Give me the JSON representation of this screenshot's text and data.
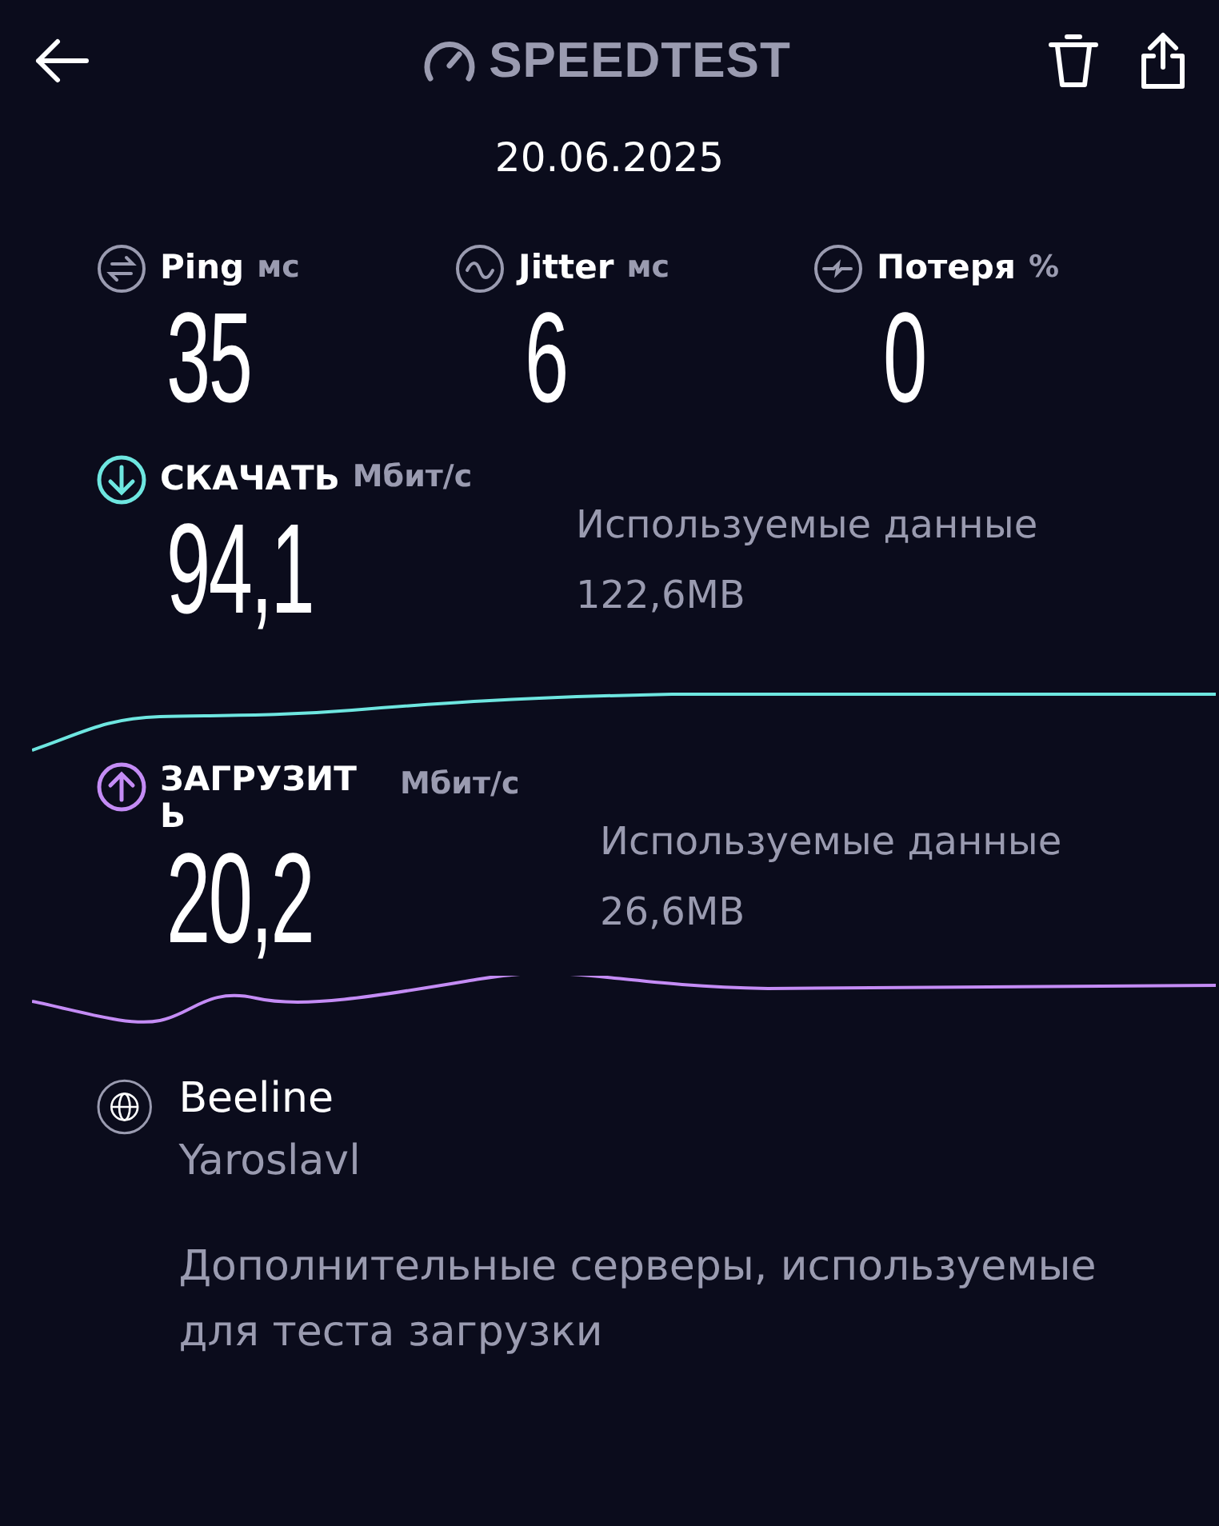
{
  "header": {
    "logo": "SPEEDTEST",
    "date": "20.06.2025"
  },
  "metrics": [
    {
      "kind": "ping",
      "label": "Ping",
      "unit": "мс",
      "value": "35"
    },
    {
      "kind": "jitter",
      "label": "Jitter",
      "unit": "мс",
      "value": "6"
    },
    {
      "kind": "loss",
      "label": "Потеря",
      "unit": "%",
      "value": "0"
    }
  ],
  "speeds": [
    {
      "kind": "download",
      "label": "СКАЧАТЬ",
      "unit": "Мбит/с",
      "value": "94,1",
      "data_label": "Используемые данные",
      "data_value": "122,6MB",
      "color": "#6ee6e0"
    },
    {
      "kind": "upload",
      "label": "ЗАГРУЗИТЬ",
      "unit": "Мбит/с",
      "value": "20,2",
      "data_label": "Используемые данные",
      "data_value": "26,6MB",
      "color": "#c48cf5"
    }
  ],
  "server": {
    "provider": "Beeline",
    "city": "Yaroslavl",
    "note": "Дополнительные серверы, используемые для теста загрузки"
  }
}
